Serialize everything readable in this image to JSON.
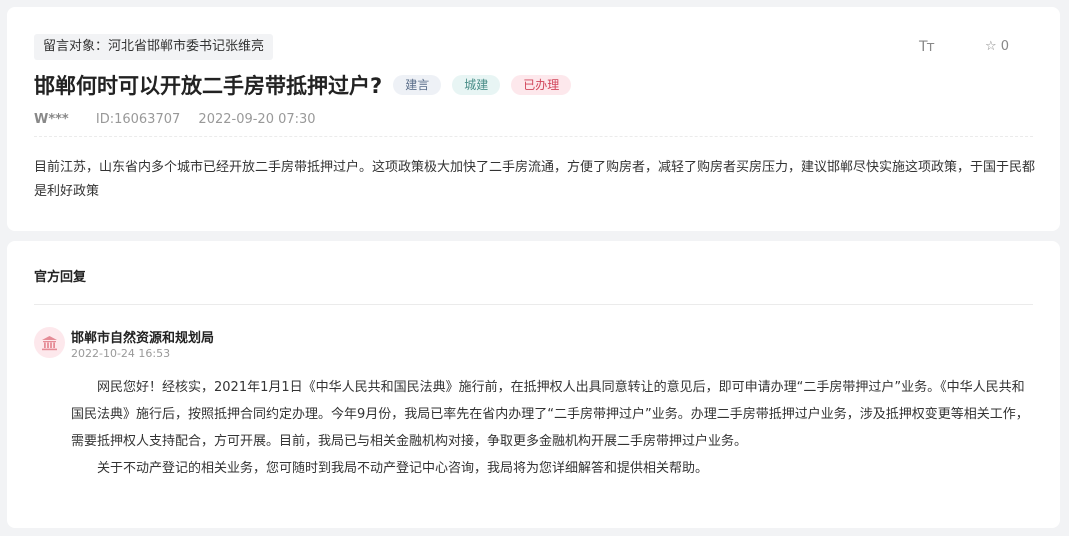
{
  "message": {
    "target_label": "留言对象：河北省邯郸市委书记张维亮",
    "font_size_label": "Tт",
    "favorite_count": "0",
    "title": "邯郸何时可以开放二手房带抵押过户?",
    "tags": [
      "建言",
      "城建",
      "已办理"
    ],
    "author": "W***",
    "id_label": "ID:16063707",
    "datetime": "2022-09-20 07:30",
    "content": "目前江苏，山东省内多个城市已经开放二手房带抵押过户。这项政策极大加快了二手房流通，方便了购房者，减轻了购房者买房压力，建议邯郸尽快实施这项政策，于国于民都是利好政策"
  },
  "reply": {
    "heading": "官方回复",
    "department": "邯郸市自然资源和规划局",
    "date": "2022-10-24 16:53",
    "paragraphs": [
      "网民您好！经核实，2021年1月1日《中华人民共和国民法典》施行前，在抵押权人出具同意转让的意见后，即可申请办理“二手房带押过户”业务。《中华人民共和国民法典》施行后，按照抵押合同约定办理。今年9月份，我局已率先在省内办理了“二手房带押过户”业务。办理二手房带抵押过户业务，涉及抵押权变更等相关工作，需要抵押权人支持配合，方可开展。目前，我局已与相关金融机构对接，争取更多金融机构开展二手房带押过户业务。",
      "关于不动产登记的相关业务，您可随时到我局不动产登记中心咨询，我局将为您详细解答和提供相关帮助。"
    ]
  },
  "icons": {
    "favorite": "star-outline-icon",
    "department": "government-building-icon"
  },
  "colors": {
    "page_bg": "#f2f3f5",
    "card_bg": "#ffffff",
    "tag_status": "#d2475c",
    "avatar_icon": "#e58b96"
  }
}
